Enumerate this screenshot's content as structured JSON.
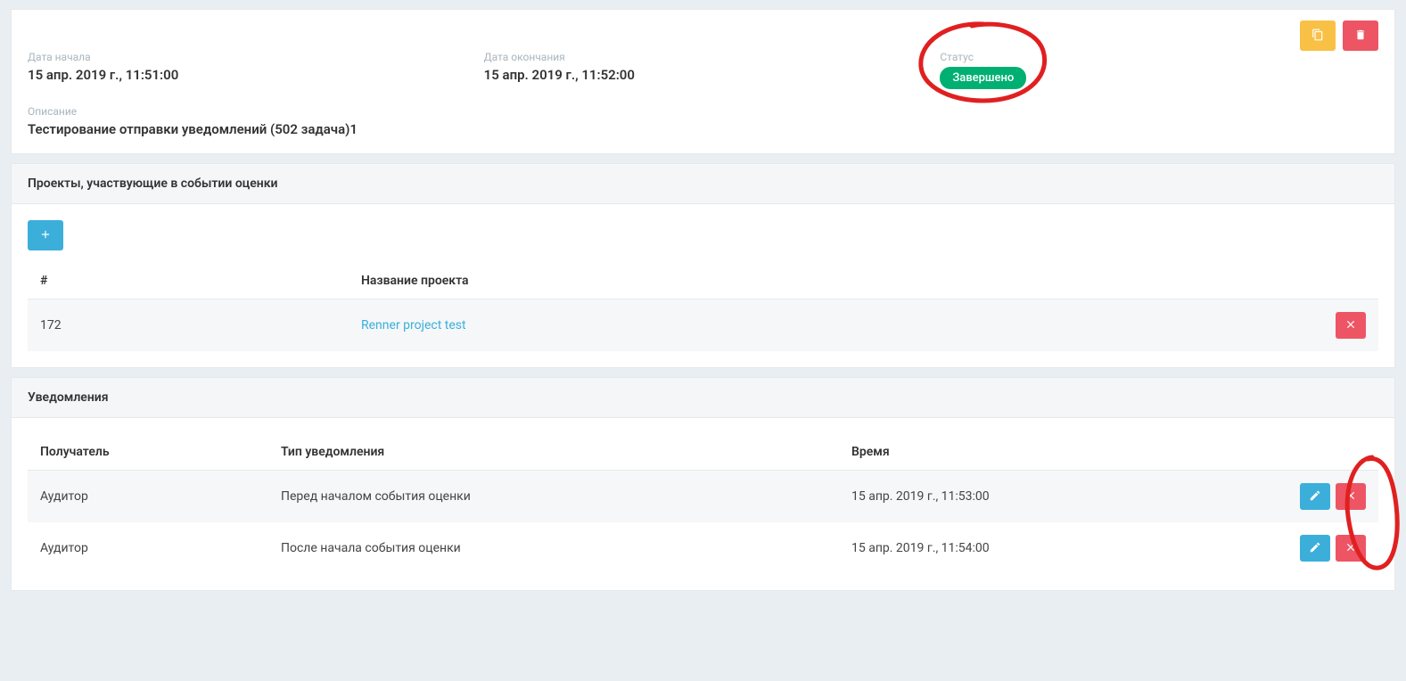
{
  "event": {
    "start_label": "Дата начала",
    "start_value": "15 апр. 2019 г., 11:51:00",
    "end_label": "Дата окончания",
    "end_value": "15 апр. 2019 г., 11:52:00",
    "status_label": "Статус",
    "status_value": "Завершено",
    "desc_label": "Описание",
    "desc_value": "Тестирование отправки уведомлений (502 задача)1"
  },
  "projects": {
    "title": "Проекты, участвующие в событии оценки",
    "columns": {
      "num": "#",
      "name": "Название проекта"
    },
    "rows": [
      {
        "num": "172",
        "name": "Renner project test"
      }
    ]
  },
  "notifications": {
    "title": "Уведомления",
    "columns": {
      "recipient": "Получатель",
      "type": "Тип уведомления",
      "time": "Время"
    },
    "rows": [
      {
        "recipient": "Аудитор",
        "type": "Перед началом события оценки",
        "time": "15 апр. 2019 г., 11:53:00"
      },
      {
        "recipient": "Аудитор",
        "type": "После начала события оценки",
        "time": "15 апр. 2019 г., 11:54:00"
      }
    ]
  }
}
